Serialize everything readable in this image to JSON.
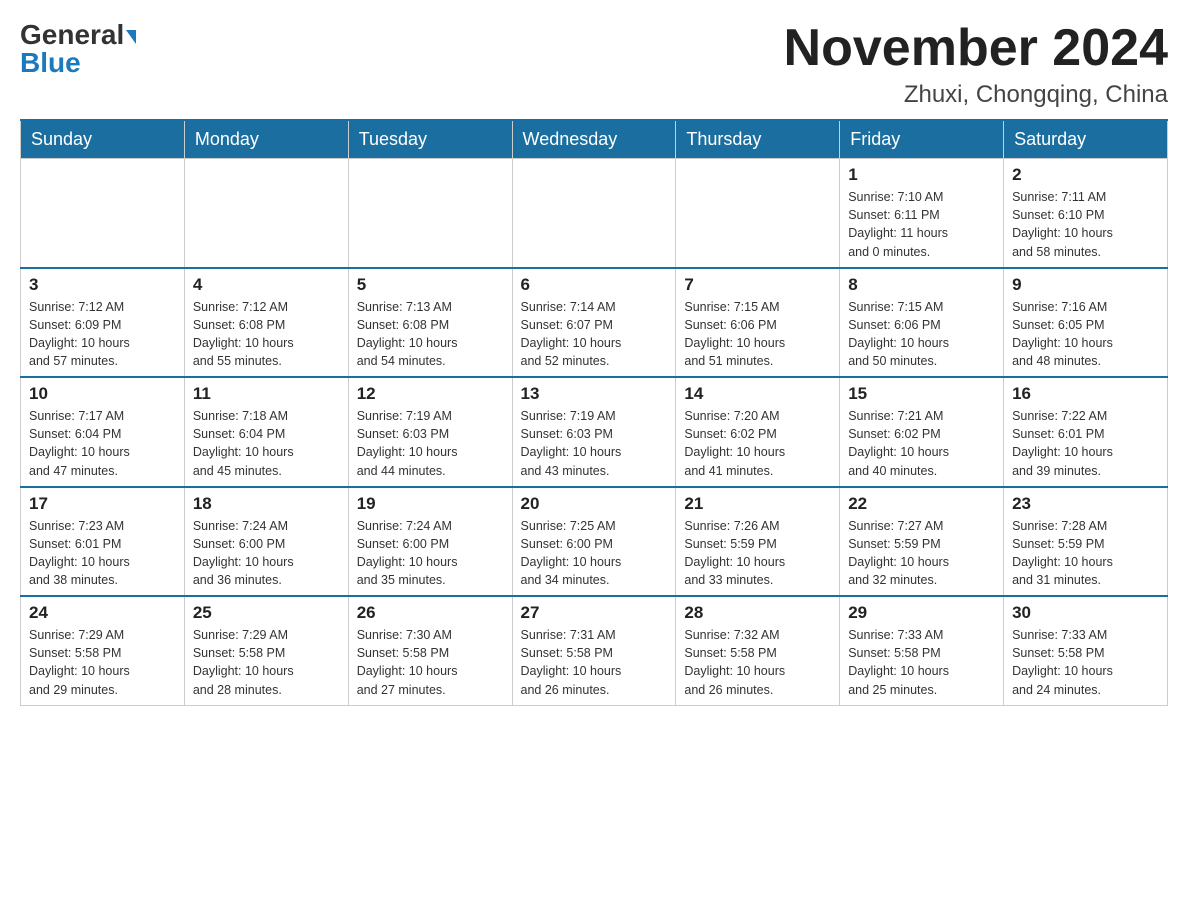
{
  "header": {
    "logo_line1": "General",
    "logo_line2": "Blue",
    "month_title": "November 2024",
    "location": "Zhuxi, Chongqing, China"
  },
  "weekdays": [
    "Sunday",
    "Monday",
    "Tuesday",
    "Wednesday",
    "Thursday",
    "Friday",
    "Saturday"
  ],
  "weeks": [
    [
      {
        "day": "",
        "info": ""
      },
      {
        "day": "",
        "info": ""
      },
      {
        "day": "",
        "info": ""
      },
      {
        "day": "",
        "info": ""
      },
      {
        "day": "",
        "info": ""
      },
      {
        "day": "1",
        "info": "Sunrise: 7:10 AM\nSunset: 6:11 PM\nDaylight: 11 hours\nand 0 minutes."
      },
      {
        "day": "2",
        "info": "Sunrise: 7:11 AM\nSunset: 6:10 PM\nDaylight: 10 hours\nand 58 minutes."
      }
    ],
    [
      {
        "day": "3",
        "info": "Sunrise: 7:12 AM\nSunset: 6:09 PM\nDaylight: 10 hours\nand 57 minutes."
      },
      {
        "day": "4",
        "info": "Sunrise: 7:12 AM\nSunset: 6:08 PM\nDaylight: 10 hours\nand 55 minutes."
      },
      {
        "day": "5",
        "info": "Sunrise: 7:13 AM\nSunset: 6:08 PM\nDaylight: 10 hours\nand 54 minutes."
      },
      {
        "day": "6",
        "info": "Sunrise: 7:14 AM\nSunset: 6:07 PM\nDaylight: 10 hours\nand 52 minutes."
      },
      {
        "day": "7",
        "info": "Sunrise: 7:15 AM\nSunset: 6:06 PM\nDaylight: 10 hours\nand 51 minutes."
      },
      {
        "day": "8",
        "info": "Sunrise: 7:15 AM\nSunset: 6:06 PM\nDaylight: 10 hours\nand 50 minutes."
      },
      {
        "day": "9",
        "info": "Sunrise: 7:16 AM\nSunset: 6:05 PM\nDaylight: 10 hours\nand 48 minutes."
      }
    ],
    [
      {
        "day": "10",
        "info": "Sunrise: 7:17 AM\nSunset: 6:04 PM\nDaylight: 10 hours\nand 47 minutes."
      },
      {
        "day": "11",
        "info": "Sunrise: 7:18 AM\nSunset: 6:04 PM\nDaylight: 10 hours\nand 45 minutes."
      },
      {
        "day": "12",
        "info": "Sunrise: 7:19 AM\nSunset: 6:03 PM\nDaylight: 10 hours\nand 44 minutes."
      },
      {
        "day": "13",
        "info": "Sunrise: 7:19 AM\nSunset: 6:03 PM\nDaylight: 10 hours\nand 43 minutes."
      },
      {
        "day": "14",
        "info": "Sunrise: 7:20 AM\nSunset: 6:02 PM\nDaylight: 10 hours\nand 41 minutes."
      },
      {
        "day": "15",
        "info": "Sunrise: 7:21 AM\nSunset: 6:02 PM\nDaylight: 10 hours\nand 40 minutes."
      },
      {
        "day": "16",
        "info": "Sunrise: 7:22 AM\nSunset: 6:01 PM\nDaylight: 10 hours\nand 39 minutes."
      }
    ],
    [
      {
        "day": "17",
        "info": "Sunrise: 7:23 AM\nSunset: 6:01 PM\nDaylight: 10 hours\nand 38 minutes."
      },
      {
        "day": "18",
        "info": "Sunrise: 7:24 AM\nSunset: 6:00 PM\nDaylight: 10 hours\nand 36 minutes."
      },
      {
        "day": "19",
        "info": "Sunrise: 7:24 AM\nSunset: 6:00 PM\nDaylight: 10 hours\nand 35 minutes."
      },
      {
        "day": "20",
        "info": "Sunrise: 7:25 AM\nSunset: 6:00 PM\nDaylight: 10 hours\nand 34 minutes."
      },
      {
        "day": "21",
        "info": "Sunrise: 7:26 AM\nSunset: 5:59 PM\nDaylight: 10 hours\nand 33 minutes."
      },
      {
        "day": "22",
        "info": "Sunrise: 7:27 AM\nSunset: 5:59 PM\nDaylight: 10 hours\nand 32 minutes."
      },
      {
        "day": "23",
        "info": "Sunrise: 7:28 AM\nSunset: 5:59 PM\nDaylight: 10 hours\nand 31 minutes."
      }
    ],
    [
      {
        "day": "24",
        "info": "Sunrise: 7:29 AM\nSunset: 5:58 PM\nDaylight: 10 hours\nand 29 minutes."
      },
      {
        "day": "25",
        "info": "Sunrise: 7:29 AM\nSunset: 5:58 PM\nDaylight: 10 hours\nand 28 minutes."
      },
      {
        "day": "26",
        "info": "Sunrise: 7:30 AM\nSunset: 5:58 PM\nDaylight: 10 hours\nand 27 minutes."
      },
      {
        "day": "27",
        "info": "Sunrise: 7:31 AM\nSunset: 5:58 PM\nDaylight: 10 hours\nand 26 minutes."
      },
      {
        "day": "28",
        "info": "Sunrise: 7:32 AM\nSunset: 5:58 PM\nDaylight: 10 hours\nand 26 minutes."
      },
      {
        "day": "29",
        "info": "Sunrise: 7:33 AM\nSunset: 5:58 PM\nDaylight: 10 hours\nand 25 minutes."
      },
      {
        "day": "30",
        "info": "Sunrise: 7:33 AM\nSunset: 5:58 PM\nDaylight: 10 hours\nand 24 minutes."
      }
    ]
  ]
}
